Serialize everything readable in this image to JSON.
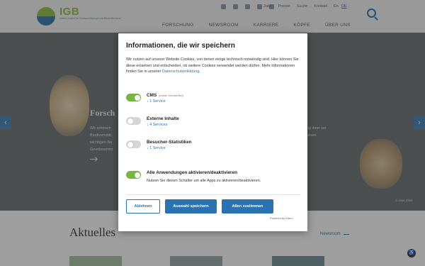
{
  "header": {
    "logo_text": "IGB",
    "logo_subtitle": "Leibniz-Institut für Gewässerökologie und Binnenfischerei",
    "social_icons": [
      "bluesky-icon",
      "youtube-icon",
      "mastodon-icon",
      "linkedin-icon",
      "instagram-icon"
    ],
    "utility_links": [
      "Jobs",
      "Presse",
      "Suche",
      "Kontakt"
    ],
    "languages": [
      "En",
      "DE"
    ],
    "nav": [
      "FORSCHUNG",
      "NEWSROOM",
      "KARRIERE",
      "KÖPFE",
      "ÜBER UNS"
    ]
  },
  "hero": {
    "title": "Forsch",
    "text_left": "Wir erforsch Biodiversität, wichtigen Be Gewässermo",
    "text_right": "ng ihrer ser einen",
    "photo_credit": "© Uwe Zitek",
    "prev_label": "‹",
    "next_label": "›"
  },
  "news": {
    "title": "Aktuelles",
    "more_link": "Newsroom"
  },
  "consent": {
    "title": "Informationen, die wir speichern",
    "description": "Wir nutzen auf unserer Website Cookies, von denen einige technisch notwendig sind. Hier können Sie diese einsehen und entscheiden, ob weitere Cookies verwendet werden dürfen. Mehr Informationen finden Sie in unserer ",
    "privacy_link": "Datenschutzerklärung",
    "privacy_suffix": ".",
    "rows": [
      {
        "label": "CMS",
        "note": "(immer erforderlich)",
        "sub": "↓ 1 Service",
        "enabled": true
      },
      {
        "label": "Externe Inhalte",
        "note": "",
        "sub": "↓ 4 Services",
        "enabled": false
      },
      {
        "label": "Besucher-Statistiken",
        "note": "",
        "sub": "↓ 1 Service",
        "enabled": false
      }
    ],
    "toggle_all": {
      "label": "Alle Anwendungen aktivieren/deaktivieren",
      "sub": "Nutzen Sie diesen Schalter um alle Apps zu aktivieren/deaktivieren.",
      "enabled": true
    },
    "buttons": {
      "decline": "Ablehnen",
      "save": "Auswahl speichern",
      "accept_all": "Allen zustimmen"
    },
    "powered_by": "Powered by Klaro!",
    "colors": {
      "accent": "#2b73b0",
      "toggle_on": "#76b643"
    }
  }
}
